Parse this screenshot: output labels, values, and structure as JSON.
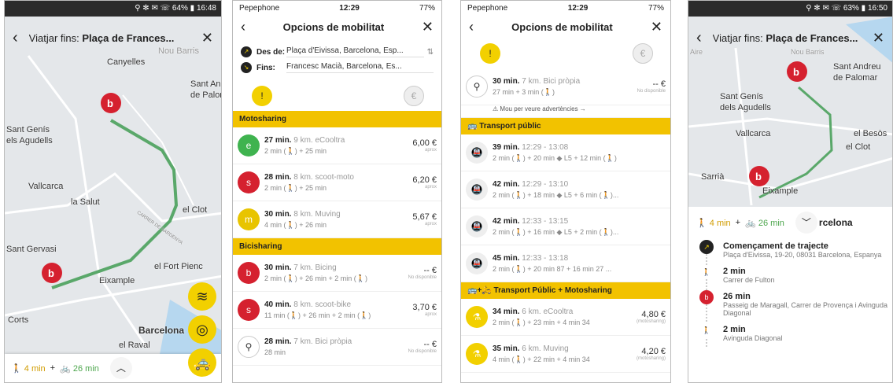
{
  "colors": {
    "yellow": "#f2d000",
    "route_green": "#5aa86a",
    "red": "#d5212f"
  },
  "p1": {
    "status": "⚲ ✻ ✉ ☏ 64% ▮ 16:48",
    "header_prefix": "Viatjar fins: ",
    "header_dest": "Plaça de Frances...",
    "map_labels": [
      "Canyelles",
      "Nou Barris",
      "Sant And",
      "de Palom",
      "Sant Genís",
      "els Agudells",
      "Vallcarca",
      "la Salut",
      "el Clot",
      "Sant Gervasi",
      "el Fort Pienc",
      "Eixample",
      "Corts",
      "Barcelona",
      "el Raval"
    ],
    "street": "CARRER DE SARDENYA",
    "walk": "4 min",
    "plus": "+",
    "bike": "26 min"
  },
  "p2": {
    "carrier": "Pepephone",
    "time": "12:29",
    "battery": "77%",
    "title": "Opcions de mobilitat",
    "from_label": "Des de:",
    "from_value": "Plaça d'Eivissa, Barcelona, Esp...",
    "to_label": "Fins:",
    "to_value": "Francesc Macià, Barcelona, Es...",
    "sections": [
      {
        "name": "Motosharing",
        "items": [
          {
            "time": "27 min.",
            "desc": "9 km. eCooltra",
            "detail": "2 min (🚶) + 25 min",
            "price": "6,00 €",
            "sub": "aprox",
            "color": "#3fb34f",
            "icon": "e"
          },
          {
            "time": "28 min.",
            "desc": "8 km. scoot-moto",
            "detail": "2 min (🚶) + 25 min",
            "price": "6,20 €",
            "sub": "aprox",
            "color": "#d5212f",
            "icon": "s"
          },
          {
            "time": "30 min.",
            "desc": "8 km. Muving",
            "detail": "4 min (🚶) + 26 min",
            "price": "5,67 €",
            "sub": "aprox",
            "color": "#e8c400",
            "icon": "m"
          }
        ]
      },
      {
        "name": "Bicisharing",
        "items": [
          {
            "time": "30 min.",
            "desc": "7 km. Bicing",
            "detail": "2 min (🚶) + 26 min + 2 min (🚶)",
            "price": "-- €",
            "sub": "No disponible",
            "color": "#d5212f",
            "icon": "b"
          },
          {
            "time": "40 min.",
            "desc": "8 km. scoot-bike",
            "detail": "11 min (🚶) + 26 min + 2 min (🚶)",
            "price": "3,70 €",
            "sub": "aprox",
            "color": "#d5212f",
            "icon": "s"
          },
          {
            "time": "28 min.",
            "desc": "7 km. Bici pròpia",
            "detail": "28 min",
            "price": "-- €",
            "sub": "No disponible",
            "color": "#ffffff",
            "icon": "ob"
          }
        ]
      }
    ]
  },
  "p3": {
    "carrier": "Pepephone",
    "time": "12:29",
    "battery": "77%",
    "title": "Opcions de mobilitat",
    "first": {
      "time": "30 min.",
      "desc": "7 km. Bici pròpia",
      "detail": "27 min + 3 min (🚶)",
      "price": "-- €",
      "sub": "No disponible"
    },
    "warning": "Mou per veure advertències →",
    "transport_title": "Transport públic",
    "transport": [
      {
        "time": "39 min.",
        "desc": "12:29 - 13:08",
        "detail": "2 min (🚶) + 20 min ◆ L5 + 12 min (🚶)"
      },
      {
        "time": "42 min.",
        "desc": "12:29 - 13:10",
        "detail": "2 min (🚶) + 18 min ◆ L5 + 6 min (🚶)..."
      },
      {
        "time": "42 min.",
        "desc": "12:33 - 13:15",
        "detail": "2 min (🚶) + 16 min ◆ L5 + 2 min (🚶)..."
      },
      {
        "time": "45 min.",
        "desc": "12:33 - 13:18",
        "detail": "2 min (🚶) + 20 min 87 + 16 min 27 ..."
      }
    ],
    "combo_title": "Transport Públic + Motosharing",
    "combo": [
      {
        "time": "34 min.",
        "desc": "6 km. eCooltra",
        "detail": "2 min (🚶) + 23 min + 4 min 34",
        "price": "4,80 €",
        "sub": "(motosharing)"
      },
      {
        "time": "35 min.",
        "desc": "6 km. Muving",
        "detail": "4 min (🚶) + 22 min + 4 min 34",
        "price": "4,20 €",
        "sub": "(motosharing)"
      }
    ]
  },
  "p4": {
    "status": "⚲ ✻ ✉ ☏ 63% ▮ 16:50",
    "header_prefix": "Viatjar fins: ",
    "header_dest": "Plaça de Frances...",
    "map_labels": [
      "Aire",
      "Nou Barris",
      "Sant Andreu",
      "de Palomar",
      "Sant Genís",
      "dels Agudells",
      "Vallcarca",
      "el Besòs",
      "el Clot",
      "Sarrià",
      "Eixample"
    ],
    "walk": "4 min",
    "plus": "+",
    "bike": "26 min",
    "city": "rcelona",
    "steps": [
      {
        "head": "Començament de trajecte",
        "sub": "Plaça d'Eivissa, 19-20, 08031 Barcelona, Espanya"
      },
      {
        "head": "2 min",
        "sub": "Carrer de Fulton"
      },
      {
        "head": "26 min",
        "sub": "Passeig de Maragall, Carrer de Provença i Avinguda Diagonal"
      },
      {
        "head": "2 min",
        "sub": "Avinguda Diagonal"
      }
    ]
  }
}
